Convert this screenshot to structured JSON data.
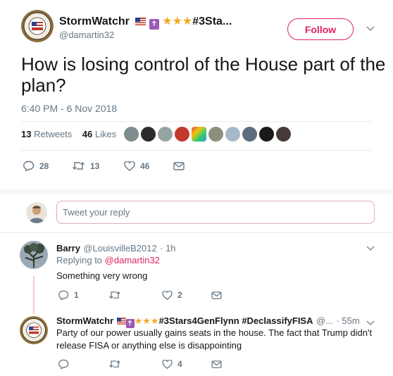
{
  "tweet": {
    "name": "StormWatchr",
    "name_suffix": "#3Sta...",
    "handle": "@damartin32",
    "follow_label": "Follow",
    "text": "How is losing control of the House part of the plan?",
    "time": "6:40 PM - 6 Nov 2018",
    "retweets_count": "13",
    "retweets_label": "Retweets",
    "likes_count": "46",
    "likes_label": "Likes",
    "actions": {
      "replies": "28",
      "retweets": "13",
      "likes": "46"
    }
  },
  "reply_box": {
    "placeholder": "Tweet your reply"
  },
  "replies": [
    {
      "name": "Barry",
      "handle": "@LouisvilleB2012",
      "time": "· 1h",
      "replying_to_label": "Replying to",
      "replying_to_handle": "@damartin32",
      "text": "Something very wrong",
      "actions": {
        "replies": "1",
        "retweets": "",
        "likes": "2"
      }
    },
    {
      "name": "StormWatchr",
      "name_suffix": "#3Stars4GenFlynn #DeclassifyFISA",
      "handle": "@...",
      "time": "· 55m",
      "text": "Party of our power usually gains seats in the house. The fact that Trump didn't release FISA or anything else is disappointing",
      "actions": {
        "replies": "",
        "retweets": "",
        "likes": "4"
      }
    }
  ],
  "colors": {
    "accent": "#e0245e",
    "link": "#1da1f2",
    "secondary_text": "#657786",
    "divider": "#e6ecf0"
  }
}
